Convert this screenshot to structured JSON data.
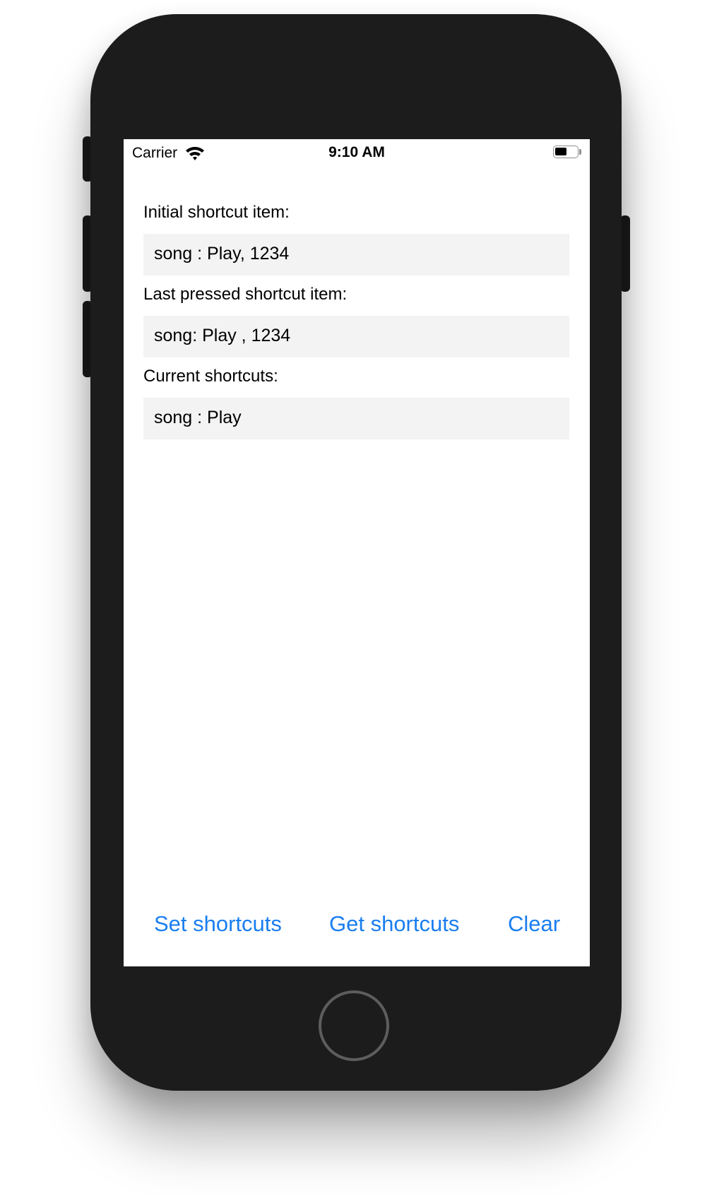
{
  "status_bar": {
    "carrier": "Carrier",
    "time": "9:10 AM",
    "icons": [
      "wifi-icon",
      "battery-icon"
    ]
  },
  "fields": [
    {
      "label": "Initial shortcut item:",
      "value": "song : Play, 1234"
    },
    {
      "label": "Last pressed shortcut item:",
      "value": "song: Play , 1234"
    },
    {
      "label": "Current shortcuts:",
      "value": "song : Play"
    }
  ],
  "actions": {
    "set": "Set shortcuts",
    "get": "Get shortcuts",
    "clear": "Clear"
  },
  "colors": {
    "accent": "#1a7ef0",
    "field_background": "#f3f3f3",
    "device_body": "#1c1c1c"
  }
}
